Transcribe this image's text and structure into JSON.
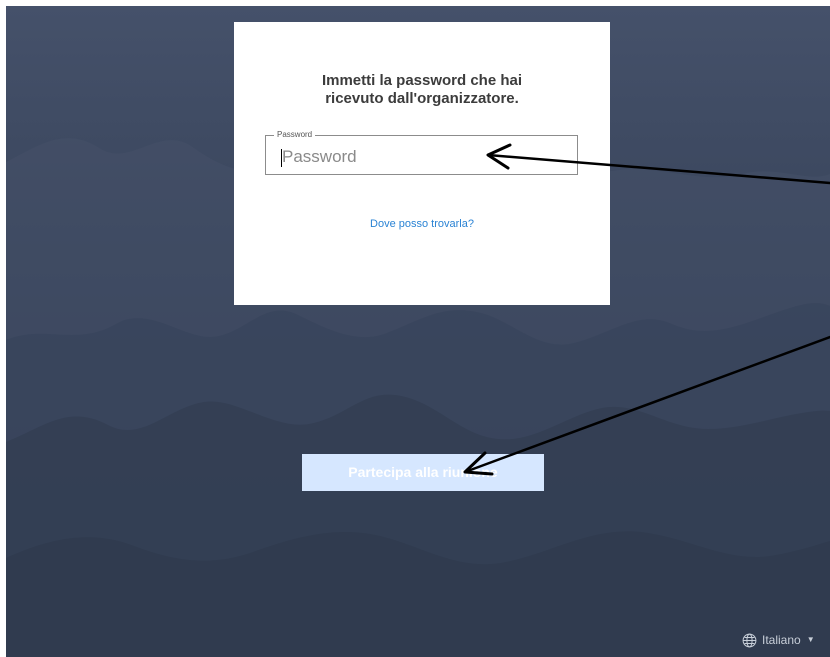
{
  "dialog": {
    "title_line_1": "Immetti la password che hai",
    "title_line_2": "ricevuto dall'organizzatore.",
    "password_label": "Password",
    "password_placeholder": "Password",
    "password_value": "",
    "help_link": "Dove posso trovarla?"
  },
  "actions": {
    "join_button": "Partecipa alla riunione"
  },
  "language": {
    "icon": "globe-icon",
    "label": "Italiano",
    "caret": "▼"
  },
  "colors": {
    "background": "#3a465d",
    "dialog": "#ffffff",
    "link": "#2a83d4",
    "button": "#d6e7ff",
    "annotation_arrows": "#000000"
  }
}
